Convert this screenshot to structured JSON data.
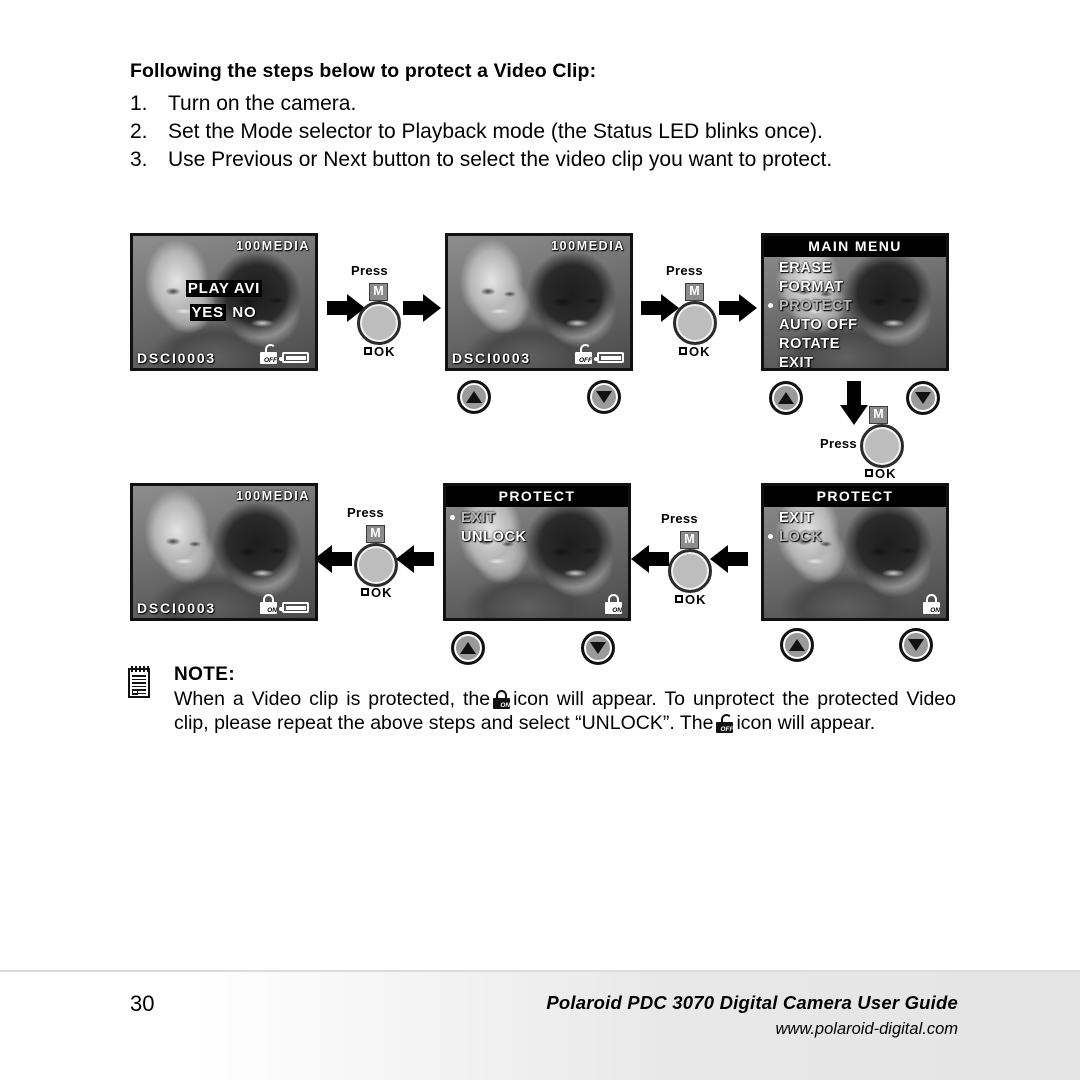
{
  "heading": "Following the steps below to protect a Video Clip:",
  "steps": [
    {
      "num": "1.",
      "text": "Turn on the camera."
    },
    {
      "num": "2.",
      "text": "Set the Mode selector to Playback mode (the Status LED blinks once)."
    },
    {
      "num": "3.",
      "text": "Use Previous or Next button to select the video clip you want to protect."
    }
  ],
  "screens": {
    "play_avi": {
      "folder": "100MEDIA",
      "file": "DSCI0003",
      "prompt": "PLAY AVI",
      "yes": "YES",
      "no": "NO",
      "lock_state": "OFF"
    },
    "playback": {
      "folder": "100MEDIA",
      "file": "DSCI0003",
      "lock_state": "OFF"
    },
    "main_menu": {
      "title": "MAIN MENU",
      "items": [
        {
          "label": "ERASE",
          "selected": false
        },
        {
          "label": "FORMAT",
          "selected": false
        },
        {
          "label": "PROTECT",
          "selected": true
        },
        {
          "label": "AUTO OFF",
          "selected": false
        },
        {
          "label": "ROTATE",
          "selected": false
        },
        {
          "label": "EXIT",
          "selected": false
        }
      ]
    },
    "protect_lock": {
      "title": "PROTECT",
      "items": [
        {
          "label": "EXIT",
          "selected": false
        },
        {
          "label": "LOCK",
          "selected": true
        }
      ],
      "lock_state": "ON"
    },
    "protect_unlock": {
      "title": "PROTECT",
      "items": [
        {
          "label": "EXIT",
          "selected": true
        },
        {
          "label": "UNLOCK",
          "selected": false
        }
      ],
      "lock_state": "ON"
    },
    "playback_locked": {
      "folder": "100MEDIA",
      "file": "DSCI0003",
      "lock_state": "ON"
    }
  },
  "controls": {
    "press_label": "Press",
    "mode_badge": "M",
    "ok_label": "OK",
    "up_icon": "triangle-up-icon",
    "down_icon": "triangle-down-icon"
  },
  "note": {
    "title": "NOTE:",
    "line1_a": "When a Video clip is protected, the",
    "line1_b": "icon will appear. To unprotect the protected Video clip, please repeat the above steps and select “UNLOCK”. The",
    "line1_c": "icon will appear.",
    "lock_on_tag": "ON",
    "lock_off_tag": "OFF"
  },
  "footer": {
    "page_number": "30",
    "title": "Polaroid PDC 3070 Digital Camera User Guide",
    "url": "www.polaroid-digital.com"
  }
}
